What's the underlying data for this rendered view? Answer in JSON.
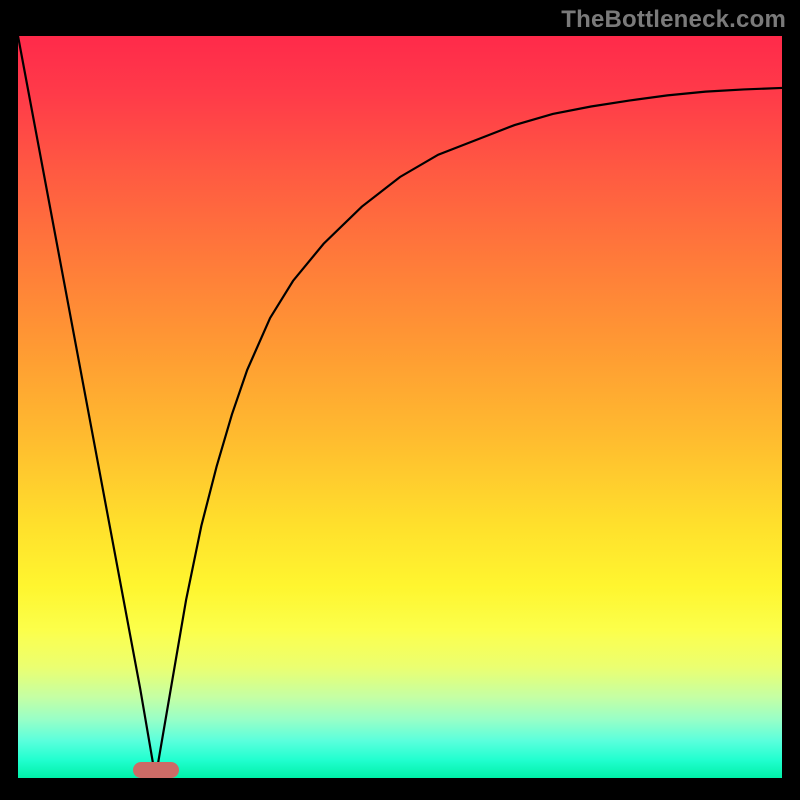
{
  "watermark": "TheBottleneck.com",
  "chart_data": {
    "type": "line",
    "title": "",
    "xlabel": "",
    "ylabel": "",
    "xlim": [
      0,
      100
    ],
    "ylim": [
      0,
      100
    ],
    "x": [
      0,
      2,
      4,
      6,
      8,
      10,
      12,
      14,
      16,
      17,
      18,
      19,
      20,
      22,
      24,
      26,
      28,
      30,
      33,
      36,
      40,
      45,
      50,
      55,
      60,
      65,
      70,
      75,
      80,
      85,
      90,
      95,
      100
    ],
    "y": [
      100,
      89,
      78,
      67,
      56,
      45,
      34,
      23,
      12,
      6,
      0,
      6,
      12,
      24,
      34,
      42,
      49,
      55,
      62,
      67,
      72,
      77,
      81,
      84,
      86,
      88,
      89.5,
      90.5,
      91.3,
      92,
      92.5,
      92.8,
      93
    ],
    "annotations": [
      {
        "type": "marker",
        "x": 18,
        "y": 0,
        "shape": "rounded-bar",
        "color": "#cc6b66"
      }
    ],
    "background_gradient": {
      "type": "vertical",
      "stops": [
        {
          "pos": 0.0,
          "color": "#ff2a4a"
        },
        {
          "pos": 0.3,
          "color": "#ff7a3a"
        },
        {
          "pos": 0.55,
          "color": "#ffbb2f"
        },
        {
          "pos": 0.75,
          "color": "#fff52f"
        },
        {
          "pos": 0.9,
          "color": "#9affc6"
        },
        {
          "pos": 1.0,
          "color": "#00f0a8"
        }
      ]
    },
    "grid": false,
    "legend": false
  }
}
